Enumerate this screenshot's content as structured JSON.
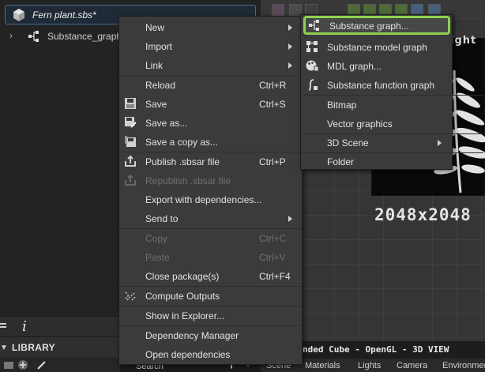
{
  "explorer": {
    "package_label": "Fern plant.sbs*",
    "package_icon": "package-cube-icon",
    "graph_label": "Substance_graph",
    "graph_icon": "substance-graph-icon",
    "tree_arrow": "›"
  },
  "explorer_bottom": {
    "info_label": "i",
    "menu_icon": "hamburger-icon"
  },
  "library": {
    "title": "LIBRARY",
    "collapse_glyph": "▼",
    "search_label": "Search",
    "chevron": "‹"
  },
  "view2d": {
    "title_fragment": "ight",
    "resolution": "2048x2048"
  },
  "view3d": {
    "title": "nded Cube - OpenGL - 3D VIEW",
    "tabs": [
      "Scene",
      "Materials",
      "Lights",
      "Camera",
      "Environment"
    ]
  },
  "context_menu": {
    "items": [
      {
        "label": "New",
        "shortcut": "",
        "submenu": true,
        "disabled": false,
        "icon": ""
      },
      {
        "label": "Import",
        "shortcut": "",
        "submenu": true,
        "disabled": false,
        "icon": ""
      },
      {
        "label": "Link",
        "shortcut": "",
        "submenu": true,
        "disabled": false,
        "icon": ""
      },
      {
        "label": "Reload",
        "shortcut": "Ctrl+R",
        "submenu": false,
        "disabled": false,
        "icon": ""
      },
      {
        "label": "Save",
        "shortcut": "Ctrl+S",
        "submenu": false,
        "disabled": false,
        "icon": "save-icon"
      },
      {
        "label": "Save as...",
        "shortcut": "",
        "submenu": false,
        "disabled": false,
        "icon": "save-as-icon"
      },
      {
        "label": "Save a copy as...",
        "shortcut": "",
        "submenu": false,
        "disabled": false,
        "icon": "save-copy-icon"
      },
      {
        "label": "Publish .sbsar file",
        "shortcut": "Ctrl+P",
        "submenu": false,
        "disabled": false,
        "icon": "publish-icon"
      },
      {
        "label": "Republish .sbsar file",
        "shortcut": "",
        "submenu": false,
        "disabled": true,
        "icon": "republish-icon"
      },
      {
        "label": "Export with dependencies...",
        "shortcut": "",
        "submenu": false,
        "disabled": false,
        "icon": ""
      },
      {
        "label": "Send to",
        "shortcut": "",
        "submenu": true,
        "disabled": false,
        "icon": ""
      },
      {
        "label": "Copy",
        "shortcut": "Ctrl+C",
        "submenu": false,
        "disabled": true,
        "icon": ""
      },
      {
        "label": "Paste",
        "shortcut": "Ctrl+V",
        "submenu": false,
        "disabled": true,
        "icon": ""
      },
      {
        "label": "Close package(s)",
        "shortcut": "Ctrl+F4",
        "submenu": false,
        "disabled": false,
        "icon": ""
      },
      {
        "label": "Compute Outputs",
        "shortcut": "",
        "submenu": false,
        "disabled": false,
        "icon": "compute-outputs-icon"
      },
      {
        "label": "Show in Explorer...",
        "shortcut": "",
        "submenu": false,
        "disabled": false,
        "icon": ""
      },
      {
        "label": "Dependency Manager",
        "shortcut": "",
        "submenu": false,
        "disabled": false,
        "icon": ""
      },
      {
        "label": "Open dependencies",
        "shortcut": "",
        "submenu": false,
        "disabled": false,
        "icon": ""
      }
    ]
  },
  "new_submenu": {
    "items": [
      {
        "label": "Substance graph...",
        "icon": "substance-graph-icon",
        "submenu": false,
        "selected": true
      },
      {
        "label": "Substance model graph",
        "icon": "model-graph-icon",
        "submenu": false,
        "selected": false
      },
      {
        "label": "MDL graph...",
        "icon": "mdl-graph-icon",
        "submenu": false,
        "selected": false
      },
      {
        "label": "Substance function graph",
        "icon": "function-graph-icon",
        "submenu": false,
        "selected": false
      },
      {
        "label": "Bitmap",
        "icon": "",
        "submenu": false,
        "selected": false
      },
      {
        "label": "Vector graphics",
        "icon": "",
        "submenu": false,
        "selected": false
      },
      {
        "label": "3D Scene",
        "icon": "",
        "submenu": true,
        "selected": false
      },
      {
        "label": "Folder",
        "icon": "",
        "submenu": false,
        "selected": false
      }
    ]
  },
  "colors": {
    "selection_highlight": "#8fd14f",
    "menu_bg": "#3b3b3b",
    "package_border": "#4a6a93"
  }
}
